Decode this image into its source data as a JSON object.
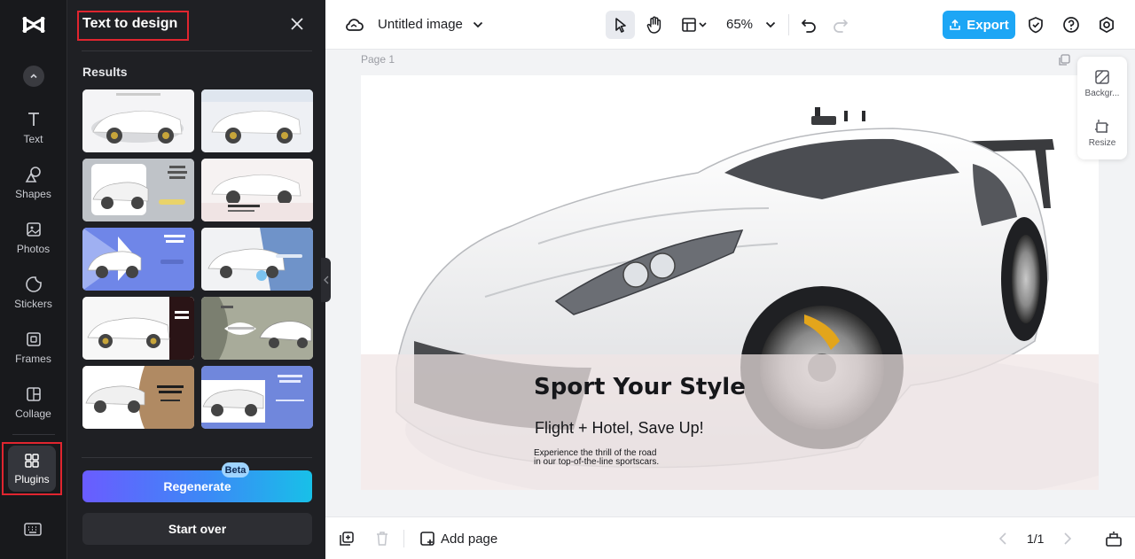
{
  "rail": {
    "items": [
      {
        "label": "Text"
      },
      {
        "label": "Shapes"
      },
      {
        "label": "Photos"
      },
      {
        "label": "Stickers"
      },
      {
        "label": "Frames"
      },
      {
        "label": "Collage"
      }
    ],
    "plugins_label": "Plugins"
  },
  "panel": {
    "title": "Text to design",
    "results_label": "Results",
    "regenerate_label": "Regenerate",
    "beta_label": "Beta",
    "start_over_label": "Start over"
  },
  "topbar": {
    "doc_title": "Untitled image",
    "zoom": "65%",
    "export_label": "Export"
  },
  "canvas": {
    "page_label": "Page 1",
    "headline": "Sport Your Style",
    "subhead": "Flight + Hotel, Save Up!",
    "body_line1": "Experience the thrill of the road",
    "body_line2": "in our top-of-the-line sportscars."
  },
  "float_panel": {
    "background_label": "Backgr...",
    "resize_label": "Resize"
  },
  "bottombar": {
    "add_page_label": "Add page",
    "pager": "1/1"
  },
  "colors": {
    "accent": "#1da6f5",
    "highlight": "#e0252f",
    "rail_bg": "#18191c",
    "panel_bg": "#1f2024"
  }
}
